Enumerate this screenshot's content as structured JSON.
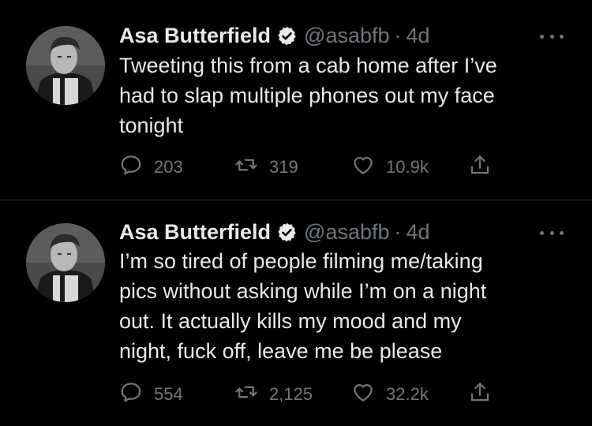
{
  "tweets": [
    {
      "author_name": "Asa Butterfield",
      "handle": "@asabfb",
      "separator": "·",
      "time": "4d",
      "text": "Tweeting this from a cab home after I’ve\nhad to slap multiple phones out my face\ntonight",
      "replies": "203",
      "retweets": "319",
      "likes": "10.9k"
    },
    {
      "author_name": "Asa Butterfield",
      "handle": "@asabfb",
      "separator": "·",
      "time": "4d",
      "text": "I’m so tired of people filming me/taking\npics without asking while I’m on a night\nout. It actually kills my mood and my\nnight, fuck off, leave me be please",
      "replies": "554",
      "retweets": "2,125",
      "likes": "32.2k"
    }
  ],
  "icons": {
    "verified": "verified-badge-icon",
    "reply": "reply-icon",
    "retweet": "retweet-icon",
    "like": "heart-icon",
    "share": "share-icon",
    "more": "more-icon"
  },
  "colors": {
    "background": "#000000",
    "text": "#e7e9ea",
    "secondary": "#71767b",
    "verified": "#e7e9ea",
    "divider": "#2f3336"
  }
}
